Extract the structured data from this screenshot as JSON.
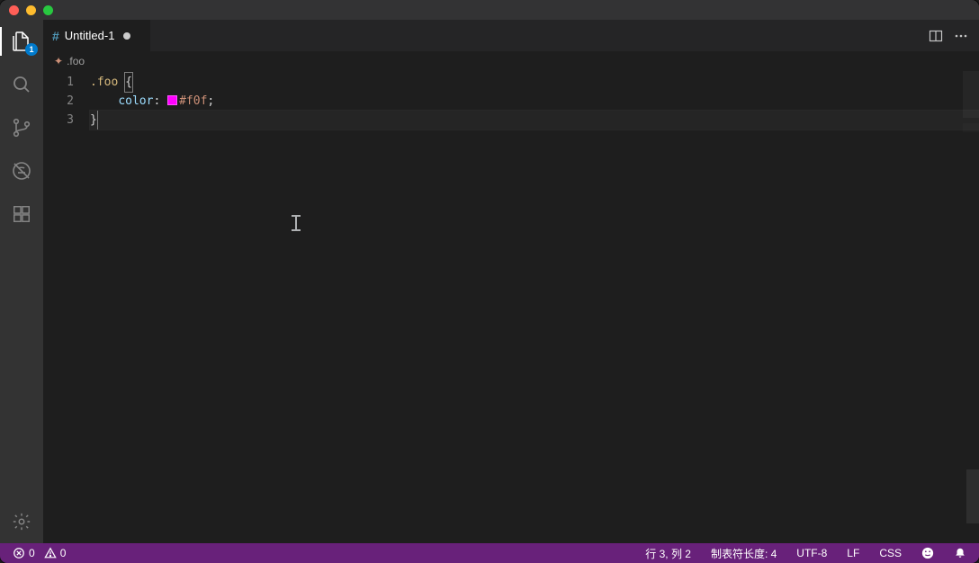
{
  "titlebar": {
    "buttons": [
      "close",
      "minimize",
      "maximize"
    ]
  },
  "activitybar": {
    "explorer_badge": "1"
  },
  "tab": {
    "icon": "#",
    "title": "Untitled-1",
    "dirty": true
  },
  "breadcrumb": {
    "icon": "sparkle",
    "path": ".foo"
  },
  "editor": {
    "gutter": [
      "1",
      "2",
      "3"
    ],
    "lines": [
      {
        "tokens": [
          {
            "t": ".foo ",
            "c": "sel"
          },
          {
            "t": "{",
            "c": "punct",
            "boxed": true
          }
        ]
      },
      {
        "indent": "    ",
        "tokens": [
          {
            "t": "color",
            "c": "prop"
          },
          {
            "t": ": ",
            "c": "punct"
          },
          {
            "swatch": "#f0f"
          },
          {
            "t": "#f0f",
            "c": "val"
          },
          {
            "t": ";",
            "c": "punct"
          }
        ]
      },
      {
        "current": true,
        "tokens": [
          {
            "t": "}",
            "c": "punct",
            "boxed": true
          }
        ]
      }
    ]
  },
  "status": {
    "errors": "0",
    "warnings": "0",
    "cursor": "行 3, 列 2",
    "tabsize": "制表符长度: 4",
    "encoding": "UTF-8",
    "eol": "LF",
    "language": "CSS"
  }
}
